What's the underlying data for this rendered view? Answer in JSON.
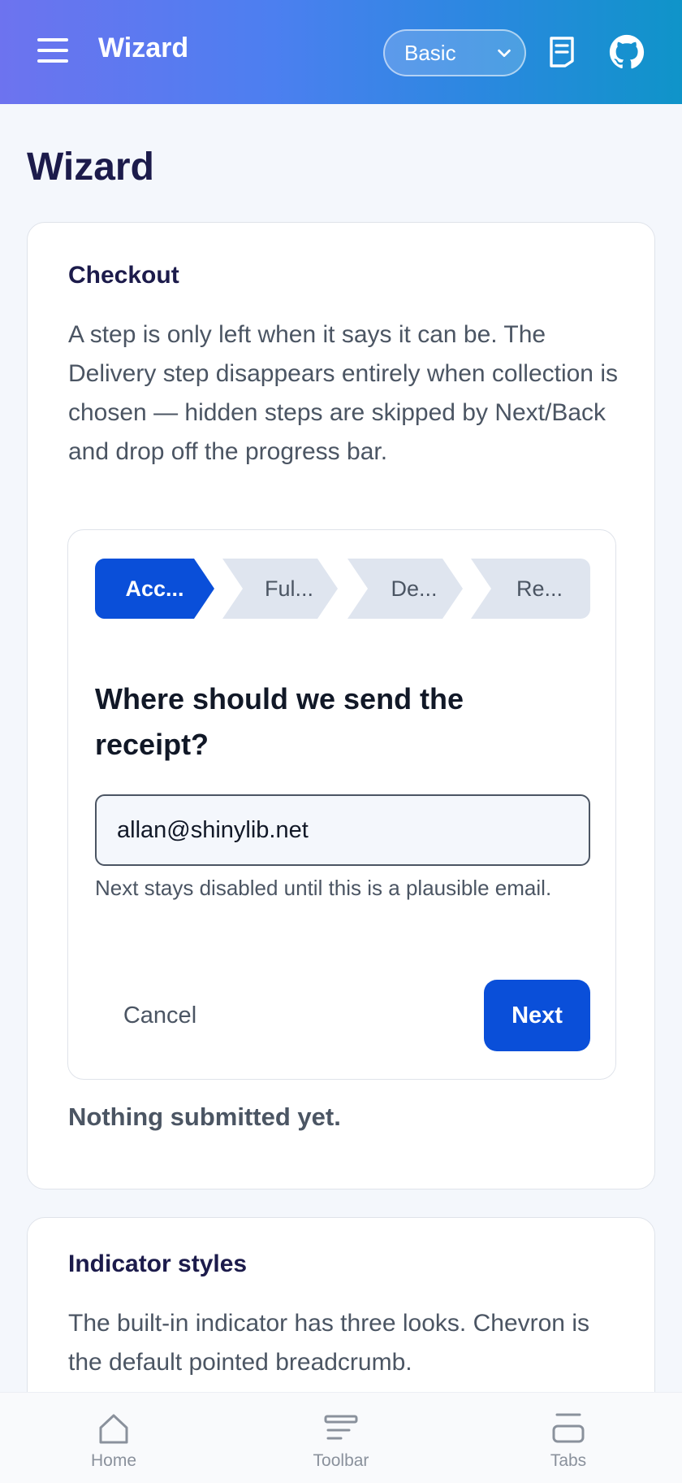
{
  "header": {
    "app_title": "Wizard",
    "mode_select_value": "Basic",
    "icons": [
      "menu-icon",
      "docs-icon",
      "github-icon"
    ]
  },
  "page": {
    "title": "Wizard"
  },
  "checkout_card": {
    "title": "Checkout",
    "description": "A step is only left when it says it can be. The Delivery step disappears entirely when collection is chosen — hidden steps are skipped by Next/Back and drop off the progress bar.",
    "wizard": {
      "steps": [
        {
          "label": "Acc...",
          "active": true
        },
        {
          "label": "Ful...",
          "active": false
        },
        {
          "label": "De...",
          "active": false
        },
        {
          "label": "Re...",
          "active": false
        }
      ],
      "question": "Where should we send the receipt?",
      "email_value": "allan@shinylib.net",
      "hint": "Next stays disabled until this is a plausible email.",
      "cancel_label": "Cancel",
      "next_label": "Next"
    },
    "status": "Nothing submitted yet."
  },
  "indicator_card": {
    "title": "Indicator styles",
    "description": "The built-in indicator has three looks. Chevron is the default pointed breadcrumb."
  },
  "bottom_nav": [
    {
      "label": "Home",
      "icon": "home-icon"
    },
    {
      "label": "Toolbar",
      "icon": "toolbar-icon"
    },
    {
      "label": "Tabs",
      "icon": "tabs-icon"
    }
  ],
  "colors": {
    "primary": "#0a4fd9",
    "header_gradient_start": "#6d73ef",
    "header_gradient_end": "#0f94c9",
    "title": "#1c1b4b"
  }
}
